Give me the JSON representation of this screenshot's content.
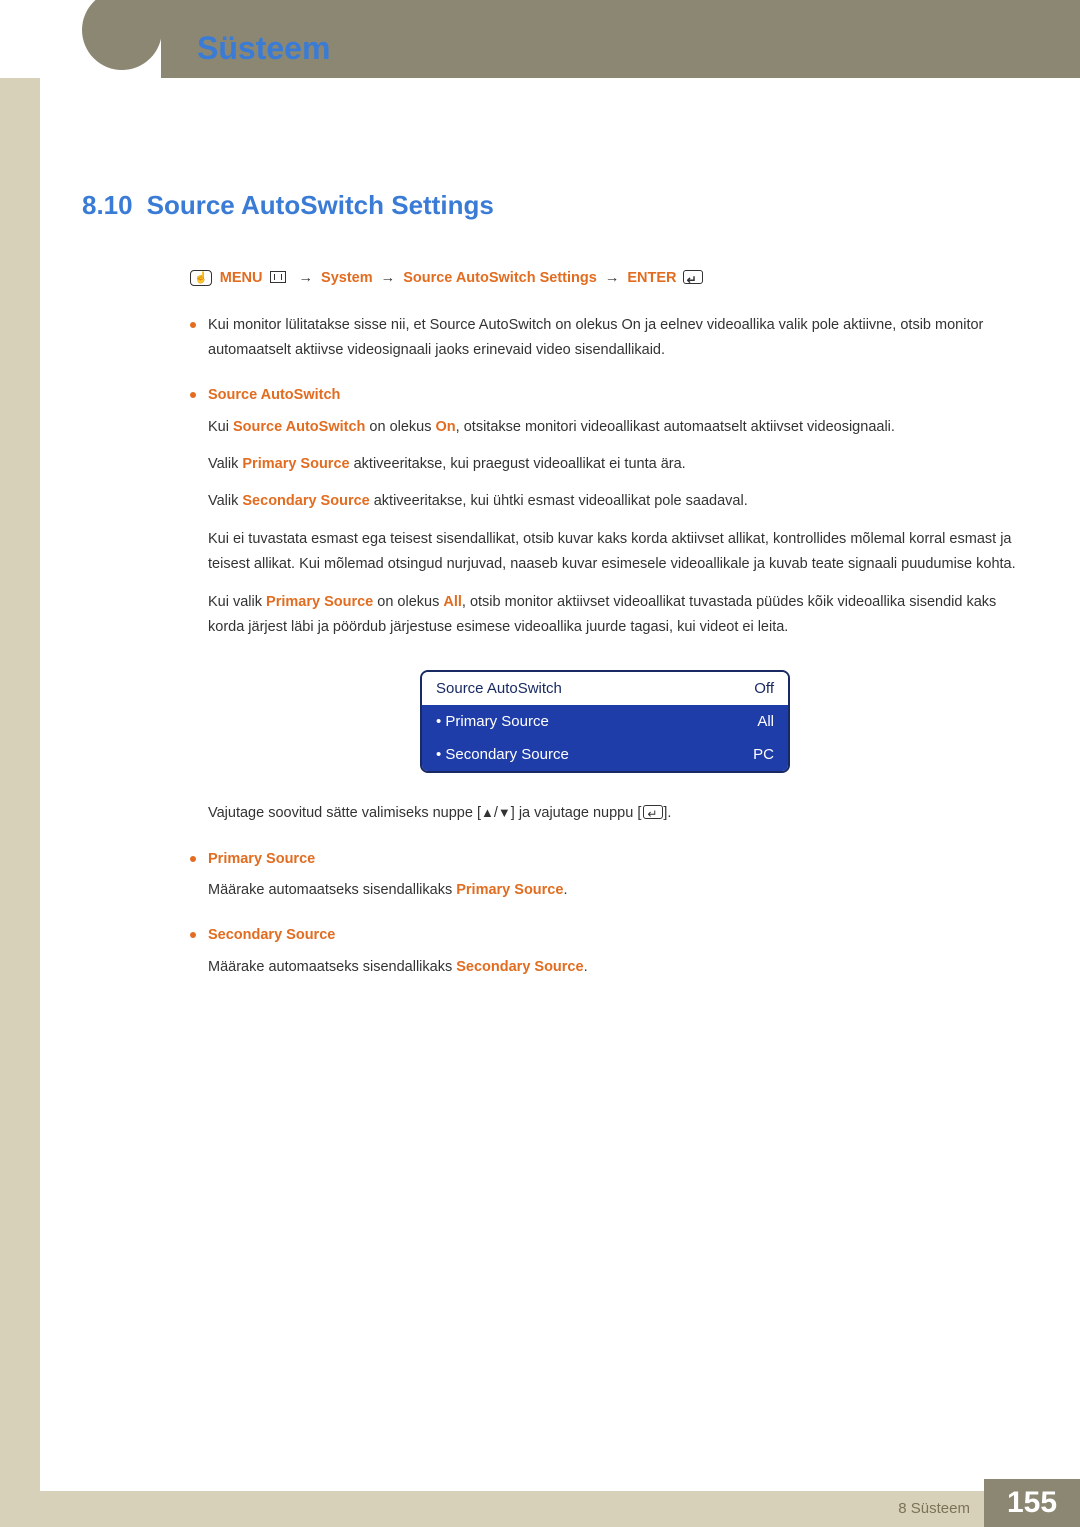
{
  "header": {
    "chapter_title": "Süsteem"
  },
  "section": {
    "number": "8.10",
    "title": "Source AutoSwitch Settings"
  },
  "nav": {
    "menu": "MENU",
    "p1": "System",
    "p2": "Source AutoSwitch Settings",
    "enter": "ENTER"
  },
  "intro": {
    "t1": "Kui monitor lülitatakse sisse nii, et ",
    "t1r1": "Source AutoSwitch",
    "t1m": " on olekus ",
    "t1r2": "On",
    "t1e": " ja eelnev videoallika valik pole aktiivne, otsib monitor automaatselt aktiivse videosignaali jaoks erinevaid video sisendallikaid."
  },
  "s1": {
    "head": "Source AutoSwitch",
    "p1a": "Kui ",
    "p1r1": "Source AutoSwitch",
    "p1b": " on olekus ",
    "p1r2": "On",
    "p1c": ", otsitakse monitori videoallikast automaatselt aktiivset videosignaali.",
    "p2a": "Valik ",
    "p2r": "Primary Source",
    "p2b": " aktiveeritakse, kui praegust videoallikat ei tunta ära.",
    "p3a": "Valik ",
    "p3r": "Secondary Source",
    "p3b": " aktiveeritakse, kui ühtki esmast videoallikat pole saadaval.",
    "p4": "Kui ei tuvastata esmast ega teisest sisendallikat, otsib kuvar kaks korda aktiivset allikat, kontrollides mõlemal korral esmast ja teisest allikat. Kui mõlemad otsingud nurjuvad, naaseb kuvar esimesele videoallikale ja kuvab teate signaali puudumise kohta.",
    "p5a": "Kui valik ",
    "p5r1": "Primary Source",
    "p5b": " on olekus ",
    "p5r2": "All",
    "p5c": ", otsib monitor aktiivset videoallikat tuvastada püüdes kõik videoallika sisendid kaks korda järjest läbi ja pöördub järjestuse esimese videoallika juurde tagasi, kui videot ei leita."
  },
  "osd": {
    "r1l": "Source AutoSwitch",
    "r1v": "Off",
    "r2l": "Primary Source",
    "r2v": "All",
    "r3l": "Secondary Source",
    "r3v": "PC"
  },
  "nav_hint": {
    "a": "Vajutage soovitud sätte valimiseks nuppe [",
    "b": "] ja vajutage nuppu [",
    "c": "]."
  },
  "s2": {
    "head": "Primary Source",
    "pa": "Määrake automaatseks sisendallikaks ",
    "pr": "Primary Source",
    "pe": "."
  },
  "s3": {
    "head": "Secondary Source",
    "pa": "Määrake automaatseks sisendallikaks ",
    "pr": "Secondary Source",
    "pe": "."
  },
  "footer": {
    "chapter": "8 Süsteem",
    "page": "155"
  }
}
